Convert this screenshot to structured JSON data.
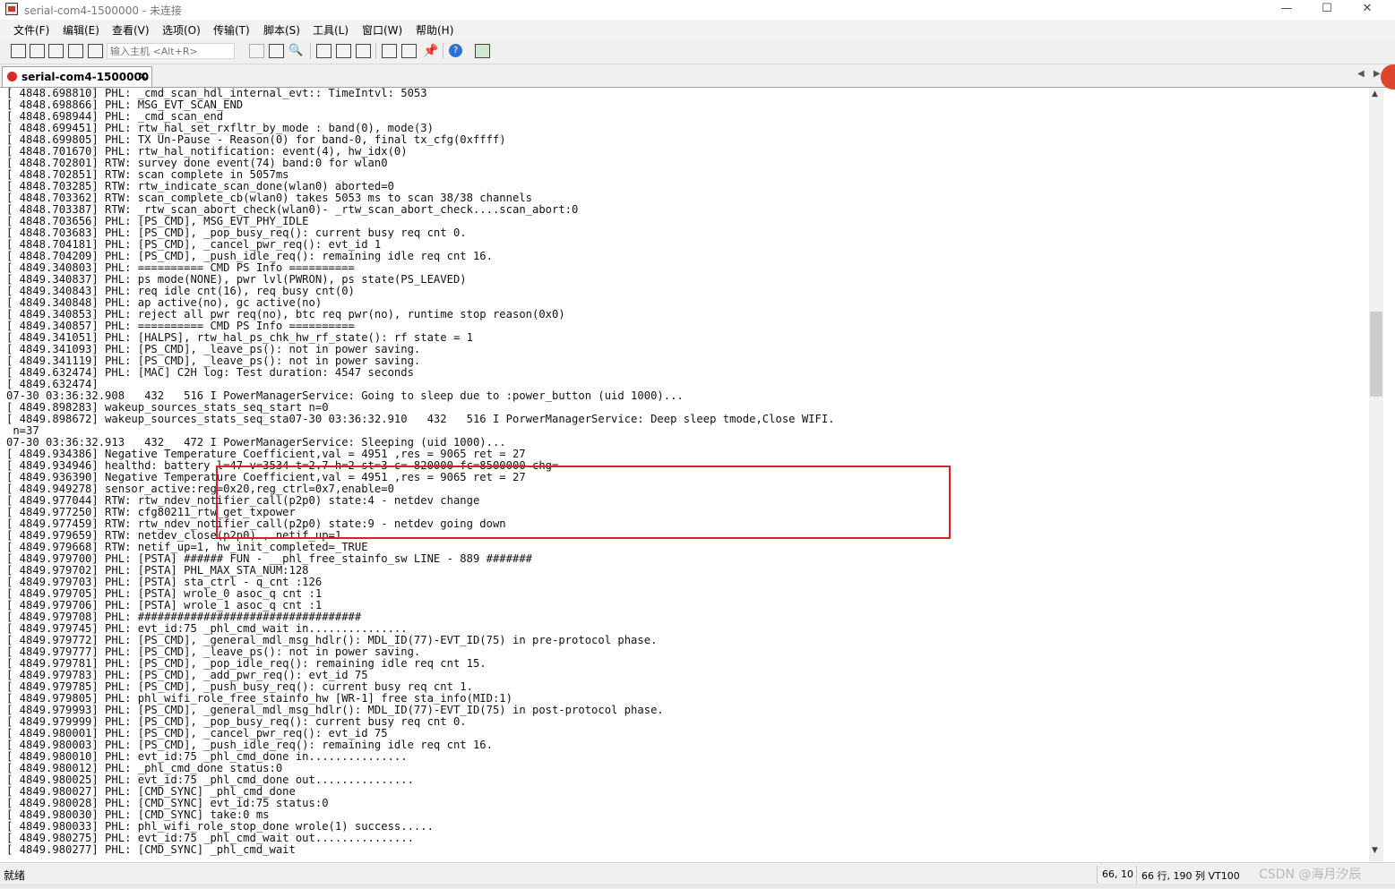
{
  "window": {
    "title": "serial-com4-1500000 - 未连接",
    "minimize": "—",
    "maximize": "☐",
    "close": "✕"
  },
  "menu": [
    "文件(F)",
    "编辑(E)",
    "查看(V)",
    "选项(O)",
    "传输(T)",
    "脚本(S)",
    "工具(L)",
    "窗口(W)",
    "帮助(H)"
  ],
  "toolbar": {
    "host_placeholder": "输入主机 <Alt+R>"
  },
  "tab": {
    "label": "serial-com4-1500000",
    "close": "×",
    "nav_left": "◀",
    "nav_right": "▶"
  },
  "terminal": {
    "lines": [
      "[ 4848.698810] PHL: _cmd_scan_hdl_internal_evt:: TimeIntvl: 5053",
      "[ 4848.698866] PHL: MSG_EVT_SCAN_END",
      "[ 4848.698944] PHL: _cmd_scan_end",
      "[ 4848.699451] PHL: rtw_hal_set_rxfltr_by_mode : band(0), mode(3)",
      "[ 4848.699805] PHL: TX Un-Pause - Reason(0) for band-0, final tx_cfg(0xffff)",
      "[ 4848.701670] PHL: rtw_hal_notification: event(4), hw_idx(0)",
      "[ 4848.702801] RTW: survey done event(74) band:0 for wlan0",
      "[ 4848.702851] RTW: scan complete in 5057ms",
      "[ 4848.703285] RTW: rtw_indicate_scan_done(wlan0) aborted=0",
      "[ 4848.703362] RTW: scan_complete_cb(wlan0) takes 5053 ms to scan 38/38 channels",
      "[ 4848.703387] RTW: _rtw_scan_abort_check(wlan0)- _rtw_scan_abort_check....scan_abort:0",
      "[ 4848.703656] PHL: [PS_CMD], MSG_EVT_PHY_IDLE",
      "[ 4848.703683] PHL: [PS_CMD], _pop_busy_req(): current busy req cnt 0.",
      "[ 4848.704181] PHL: [PS_CMD], _cancel_pwr_req(): evt_id 1",
      "[ 4848.704209] PHL: [PS_CMD], _push_idle_req(): remaining idle req cnt 16.",
      "[ 4849.340803] PHL: ========== CMD PS Info ==========",
      "[ 4849.340837] PHL: ps mode(NONE), pwr lvl(PWRON), ps state(PS_LEAVED)",
      "[ 4849.340843] PHL: req idle cnt(16), req busy cnt(0)",
      "[ 4849.340848] PHL: ap active(no), gc active(no)",
      "[ 4849.340853] PHL: reject all pwr req(no), btc req pwr(no), runtime stop reason(0x0)",
      "[ 4849.340857] PHL: ========== CMD PS Info ==========",
      "[ 4849.341051] PHL: [HALPS], rtw_hal_ps_chk_hw_rf_state(): rf state = 1",
      "[ 4849.341093] PHL: [PS_CMD], _leave_ps(): not in power saving.",
      "[ 4849.341119] PHL: [PS_CMD], _leave_ps(): not in power saving.",
      "[ 4849.632474] PHL: [MAC] C2H log: Test duration: 4547 seconds",
      "[ 4849.632474]",
      "07-30 03:36:32.908   432   516 I PowerManagerService: Going to sleep due to :power_button (uid 1000)...",
      "[ 4849.898283] wakeup_sources_stats_seq_start n=0",
      "[ 4849.898672] wakeup_sources_stats_seq_sta07-30 03:36:32.910   432   516 I PorwerManagerService: Deep sleep tmode,Close WIFI.",
      " n=37",
      "07-30 03:36:32.913   432   472 I PowerManagerService: Sleeping (uid 1000)...",
      "[ 4849.934386] Negative Temperature Coefficient,val = 4951 ,res = 9065 ret = 27",
      "[ 4849.934946] healthd: battery l=47 v=3534 t=2.7 h=2 st=3 c=-820000 fc=8500000 chg=",
      "[ 4849.936390] Negative Temperature Coefficient,val = 4951 ,res = 9065 ret = 27",
      "[ 4849.949278] sensor_active:reg=0x20,reg_ctrl=0x7,enable=0",
      "[ 4849.977044] RTW: rtw_ndev_notifier_call(p2p0) state:4 - netdev change",
      "[ 4849.977250] RTW: cfg80211_rtw_get_txpower",
      "[ 4849.977459] RTW: rtw_ndev_notifier_call(p2p0) state:9 - netdev going down",
      "[ 4849.979659] RTW: netdev_close(p2p0) , netif_up=1",
      "[ 4849.979668] RTW: netif_up=1, hw_init_completed=_TRUE",
      "[ 4849.979700] PHL: [PSTA] ###### FUN - __phl_free_stainfo_sw LINE - 889 #######",
      "[ 4849.979702] PHL: [PSTA] PHL_MAX_STA_NUM:128",
      "[ 4849.979703] PHL: [PSTA] sta_ctrl - q_cnt :126",
      "[ 4849.979705] PHL: [PSTA] wrole_0 asoc_q cnt :1",
      "[ 4849.979706] PHL: [PSTA] wrole_1 asoc_q cnt :1",
      "[ 4849.979708] PHL: ##################################",
      "[ 4849.979745] PHL: evt_id:75 _phl_cmd_wait in...............",
      "[ 4849.979772] PHL: [PS_CMD], _general_mdl_msg_hdlr(): MDL_ID(77)-EVT_ID(75) in pre-protocol phase.",
      "[ 4849.979777] PHL: [PS_CMD], _leave_ps(): not in power saving.",
      "[ 4849.979781] PHL: [PS_CMD], _pop_idle_req(): remaining idle req cnt 15.",
      "[ 4849.979783] PHL: [PS_CMD], _add_pwr_req(): evt_id 75",
      "[ 4849.979785] PHL: [PS_CMD], _push_busy_req(): current busy req cnt 1.",
      "[ 4849.979805] PHL: phl_wifi_role_free_stainfo_hw [WR-1] free sta_info(MID:1)",
      "[ 4849.979993] PHL: [PS_CMD], _general_mdl_msg_hdlr(): MDL_ID(77)-EVT_ID(75) in post-protocol phase.",
      "[ 4849.979999] PHL: [PS_CMD], _pop_busy_req(): current busy req cnt 0.",
      "[ 4849.980001] PHL: [PS_CMD], _cancel_pwr_req(): evt_id 75",
      "[ 4849.980003] PHL: [PS_CMD], _push_idle_req(): remaining idle req cnt 16.",
      "[ 4849.980010] PHL: evt_id:75 _phl_cmd_done in...............",
      "[ 4849.980012] PHL: _phl_cmd_done status:0",
      "[ 4849.980025] PHL: evt_id:75 _phl_cmd_done out...............",
      "[ 4849.980027] PHL: [CMD_SYNC] _phl_cmd_done",
      "[ 4849.980028] PHL: [CMD_SYNC] evt_id:75 status:0",
      "[ 4849.980030] PHL: [CMD_SYNC] take:0 ms",
      "[ 4849.980033] PHL: phl_wifi_role_stop_done wrole(1) success.....",
      "[ 4849.980275] PHL: evt_id:75 _phl_cmd_wait out...............",
      "[ 4849.980277] PHL: [CMD_SYNC] _phl_cmd_wait"
    ]
  },
  "scrollbar": {
    "up": "▲",
    "down": "▼"
  },
  "status": {
    "ready": "就绪",
    "position": "66,  10",
    "rowcol": "66 行, 190 列  VT100",
    "watermark": "CSDN @海月汐辰"
  }
}
